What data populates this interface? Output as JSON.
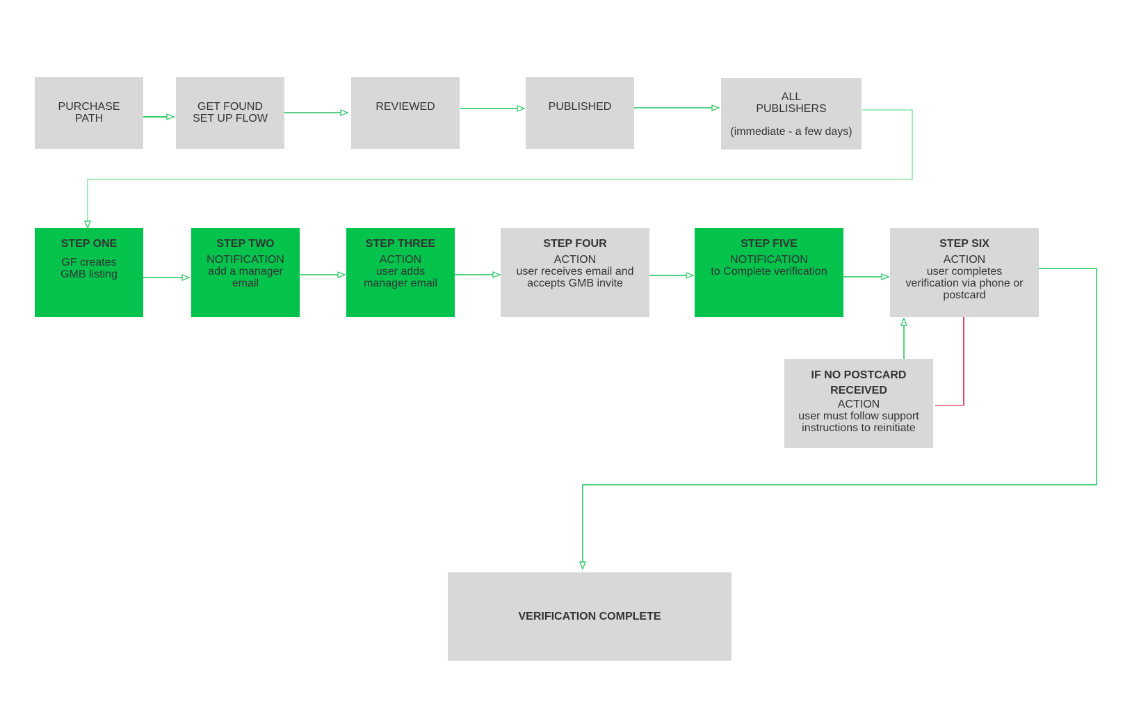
{
  "diagram": {
    "colors": {
      "gray_box": "#d8d8d8",
      "green_box": "#03c34c",
      "edge_green": "#1dc25a",
      "edge_light_green": "#86e0a6",
      "edge_red": "#c8102e",
      "edge_pink": "#e8808f",
      "text": "#333333"
    },
    "top_row": [
      {
        "id": "purchase-path",
        "lines": [
          "PURCHASE",
          "PATH"
        ]
      },
      {
        "id": "get-found-setup",
        "lines": [
          "GET FOUND",
          "SET UP FLOW"
        ]
      },
      {
        "id": "reviewed",
        "lines": [
          "REVIEWED"
        ]
      },
      {
        "id": "published",
        "lines": [
          "PUBLISHED"
        ]
      },
      {
        "id": "all-publishers",
        "lines": [
          "ALL",
          "PUBLISHERS"
        ],
        "note": "(immediate - a few days)"
      }
    ],
    "steps": [
      {
        "id": "step-one",
        "title": "STEP ONE",
        "lines": [
          "GF creates",
          "GMB listing"
        ],
        "color": "green"
      },
      {
        "id": "step-two",
        "title": "STEP TWO",
        "lines": [
          "NOTIFICATION",
          "add a manager",
          "email"
        ],
        "color": "green"
      },
      {
        "id": "step-three",
        "title": "STEP THREE",
        "lines": [
          "ACTION",
          "user adds",
          "manager email"
        ],
        "color": "green"
      },
      {
        "id": "step-four",
        "title": "STEP FOUR",
        "lines": [
          "ACTION",
          "user receives email and",
          "accepts GMB invite"
        ],
        "color": "gray"
      },
      {
        "id": "step-five",
        "title": "STEP FIVE",
        "lines": [
          "NOTIFICATION",
          "to Complete verification"
        ],
        "color": "green"
      },
      {
        "id": "step-six",
        "title": "STEP SIX",
        "lines": [
          "ACTION",
          "user completes",
          "verification via phone or",
          "postcard"
        ],
        "color": "gray"
      }
    ],
    "no_postcard": {
      "title_lines": [
        "IF NO POSTCARD",
        "RECEIVED"
      ],
      "lines": [
        "ACTION",
        "user must follow support",
        "instructions to reinitiate"
      ]
    },
    "final": {
      "title": "VERIFICATION COMPLETE"
    },
    "edges": [
      {
        "from": "purchase-path",
        "to": "get-found-setup",
        "color": "green"
      },
      {
        "from": "get-found-setup",
        "to": "reviewed",
        "color": "green"
      },
      {
        "from": "reviewed",
        "to": "published",
        "color": "green"
      },
      {
        "from": "published",
        "to": "all-publishers",
        "color": "green"
      },
      {
        "from": "all-publishers",
        "to": "step-one",
        "color": "light-green"
      },
      {
        "from": "step-one",
        "to": "step-two",
        "color": "green"
      },
      {
        "from": "step-two",
        "to": "step-three",
        "color": "green"
      },
      {
        "from": "step-three",
        "to": "step-four",
        "color": "green"
      },
      {
        "from": "step-four",
        "to": "step-five",
        "color": "green"
      },
      {
        "from": "step-five",
        "to": "step-six",
        "color": "green"
      },
      {
        "from": "step-six",
        "to": "no-postcard",
        "color": "red"
      },
      {
        "from": "no-postcard",
        "to": "step-six",
        "color": "green"
      },
      {
        "from": "step-six",
        "to": "verification-complete",
        "color": "green"
      }
    ]
  }
}
